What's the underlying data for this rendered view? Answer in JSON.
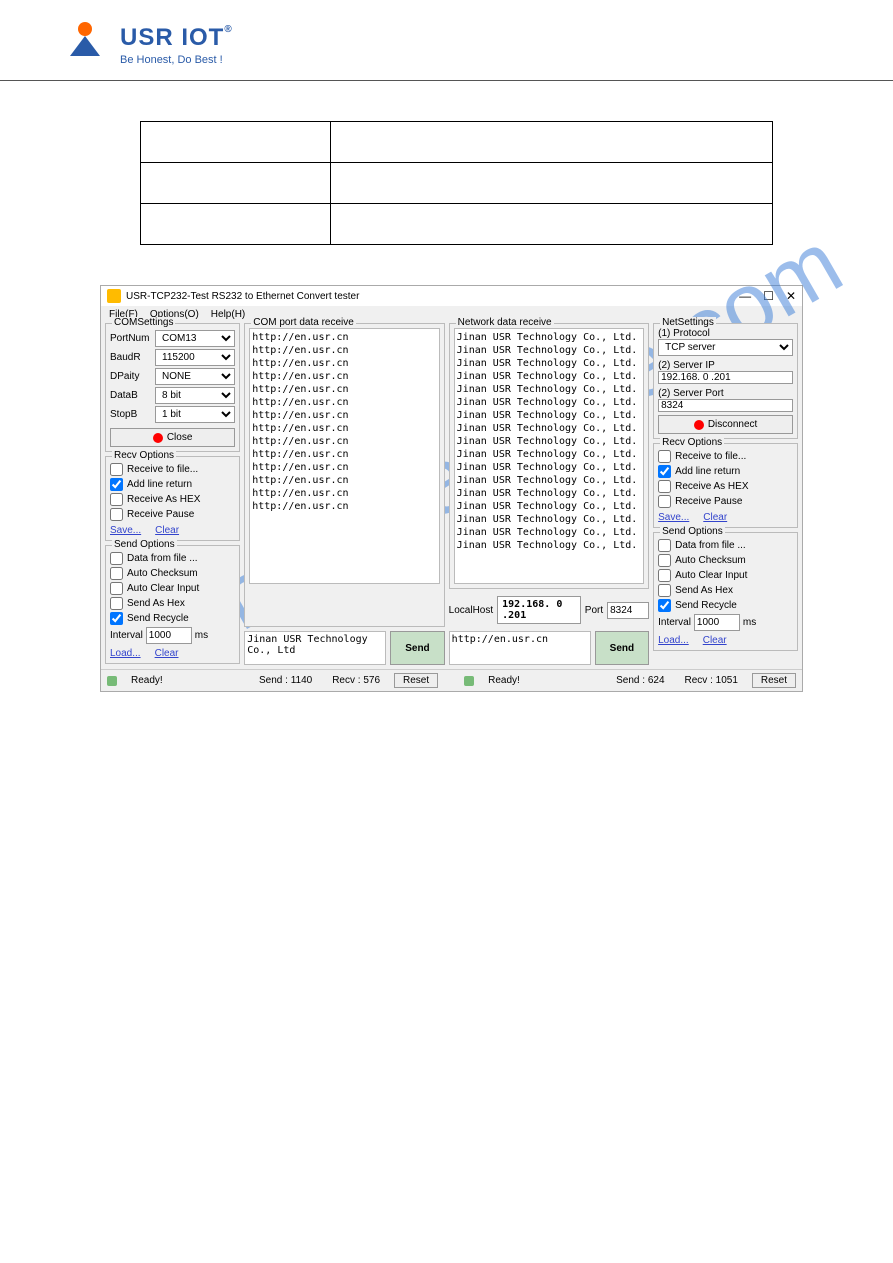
{
  "brand": {
    "name": "USR IOT",
    "sub": "Be Honest, Do Best !"
  },
  "app": {
    "title": "USR-TCP232-Test RS232 to Ethernet Convert tester",
    "menu": {
      "file": "File(F)",
      "options": "Options(O)",
      "help": "Help(H)"
    },
    "com": {
      "group": "COMSettings",
      "portnum": {
        "label": "PortNum",
        "value": "COM13"
      },
      "baud": {
        "label": "BaudR",
        "value": "115200"
      },
      "parity": {
        "label": "DPaity",
        "value": "NONE"
      },
      "datab": {
        "label": "DataB",
        "value": "8 bit"
      },
      "stopb": {
        "label": "StopB",
        "value": "1 bit"
      },
      "close": "Close"
    },
    "recv": {
      "group": "Recv Options",
      "tofile": "Receive to file...",
      "addline": "Add line return",
      "ashex": "Receive As HEX",
      "pause": "Receive Pause",
      "save": "Save...",
      "clear": "Clear"
    },
    "send": {
      "group": "Send Options",
      "fromfile": "Data from file ...",
      "checksum": "Auto Checksum",
      "clearinput": "Auto Clear Input",
      "ashex": "Send As Hex",
      "recycle": "Send Recycle",
      "interval_label": "Interval",
      "interval_val": "1000",
      "interval_unit": "ms",
      "load": "Load...",
      "clear": "Clear"
    },
    "comdata": {
      "group": "COM port data receive",
      "lines": [
        "http://en.usr.cn",
        "http://en.usr.cn",
        "http://en.usr.cn",
        "http://en.usr.cn",
        "http://en.usr.cn",
        "http://en.usr.cn",
        "http://en.usr.cn",
        "http://en.usr.cn",
        "http://en.usr.cn",
        "http://en.usr.cn",
        "http://en.usr.cn",
        "http://en.usr.cn",
        "http://en.usr.cn",
        "http://en.usr.cn"
      ],
      "sendbox": "Jinan USR Technology Co., Ltd",
      "sendbtn": "Send"
    },
    "netdata": {
      "group": "Network data receive",
      "lines": [
        "Jinan USR Technology Co., Ltd.",
        "Jinan USR Technology Co., Ltd.",
        "Jinan USR Technology Co., Ltd.",
        "Jinan USR Technology Co., Ltd.",
        "Jinan USR Technology Co., Ltd.",
        "Jinan USR Technology Co., Ltd.",
        "Jinan USR Technology Co., Ltd.",
        "Jinan USR Technology Co., Ltd.",
        "Jinan USR Technology Co., Ltd.",
        "Jinan USR Technology Co., Ltd.",
        "Jinan USR Technology Co., Ltd.",
        "Jinan USR Technology Co., Ltd.",
        "Jinan USR Technology Co., Ltd.",
        "Jinan USR Technology Co., Ltd.",
        "Jinan USR Technology Co., Ltd.",
        "Jinan USR Technology Co., Ltd.",
        "Jinan USR Technology Co., Ltd."
      ],
      "localhost_label": "LocalHost",
      "localhost_val": "192.168. 0 .201",
      "port_label": "Port",
      "port_val": "8324",
      "sendbox": "http://en.usr.cn",
      "sendbtn": "Send"
    },
    "net": {
      "group": "NetSettings",
      "proto_label": "(1) Protocol",
      "proto_val": "TCP server",
      "ip_label": "(2) Server IP",
      "ip_val": "192.168. 0 .201",
      "port_label": "(2) Server Port",
      "port_val": "8324",
      "disconnect": "Disconnect"
    },
    "recv2": {
      "group": "Recv Options",
      "tofile": "Receive to file...",
      "addline": "Add line return",
      "ashex": "Receive As HEX",
      "pause": "Receive Pause",
      "save": "Save...",
      "clear": "Clear"
    },
    "send2": {
      "group": "Send Options",
      "fromfile": "Data from file ...",
      "checksum": "Auto Checksum",
      "clearinput": "Auto Clear Input",
      "ashex": "Send As Hex",
      "recycle": "Send Recycle",
      "interval_label": "Interval",
      "interval_val": "1000",
      "interval_unit": "ms",
      "load": "Load...",
      "clear": "Clear"
    },
    "status": {
      "ready1": "Ready!",
      "send1": "Send : 1140",
      "recv1": "Recv : 576",
      "reset1": "Reset",
      "ready2": "Ready!",
      "send2": "Send : 624",
      "recv2": "Recv : 1051",
      "reset2": "Reset"
    }
  }
}
